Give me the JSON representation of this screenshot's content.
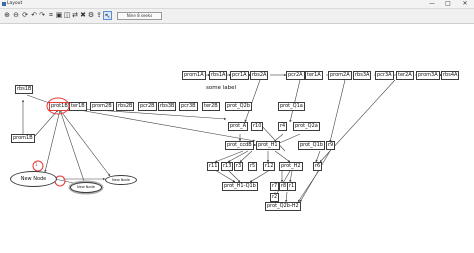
{
  "window": {
    "title": "Layout",
    "minimize": "—",
    "maximize": "□",
    "close": "✕"
  },
  "toolbar": {
    "icons": [
      "zoom-in-icon",
      "zoom-out-icon",
      "rotate-icon",
      "undo-icon",
      "redo-icon",
      "layout-icon",
      "select-icon",
      "node-icon",
      "edge-icon",
      "delete-icon",
      "settings-icon",
      "export-icon",
      "cursor-icon"
    ],
    "node_count": "Nine 8 seeks"
  },
  "graph": {
    "nodes": {
      "rbs1b": "rbs1B",
      "prot1b": "prot1B",
      "ter1b": "ter1B",
      "prom2b": "prom2B",
      "rbs2b": "rbs2B",
      "pcr2b": "pcr2B",
      "rbs3b": "rbs3B",
      "pcr3b": "pcr3B",
      "ter2b": "ter2B",
      "prom1b": "prom1B",
      "prom1a": "prom1A",
      "rbs1a": "rbs1A",
      "pcr1a": "pcr1A",
      "rbs2a": "rbs2A",
      "pcr2a": "pcr2A",
      "ter1a": "ter1A",
      "prom2a": "prom2A",
      "rbs3a": "rbs3A",
      "pcr3a": "pcr3A",
      "ter2a": "ter2A",
      "prom3a": "prom3A",
      "rbs4a": "rbs4A",
      "prot_q2b": "prot_Q2b",
      "prot_q1a": "prot_Q1a",
      "prot_a": "prot_A",
      "r10": "r10",
      "r4": "r4",
      "prot_q2a": "prot_Q2a",
      "prot_ccdb": "prot_ccdB",
      "prot_h1": "prot_H1",
      "prot_q1b": "prot_Q1b",
      "r9": "r9",
      "r11": "r11",
      "r13": "r13",
      "r3": "r3",
      "r5": "r5",
      "r12": "r12",
      "prot_h2": "prot_H2",
      "r6": "r6",
      "r7": "r7",
      "r8": "r8",
      "r1": "r1",
      "prot_h1_q1b": "prot_H1-Q1b",
      "r2": "r2",
      "prot_q2b_h2": "prot_Q2b-H2"
    },
    "free_label": "some label",
    "new_node": "New Node",
    "new_node_small_1": "New Node",
    "new_node_small_2": "New Node",
    "node_marker": "1",
    "edge_color": "#444444",
    "highlight_color": "#e53935"
  }
}
